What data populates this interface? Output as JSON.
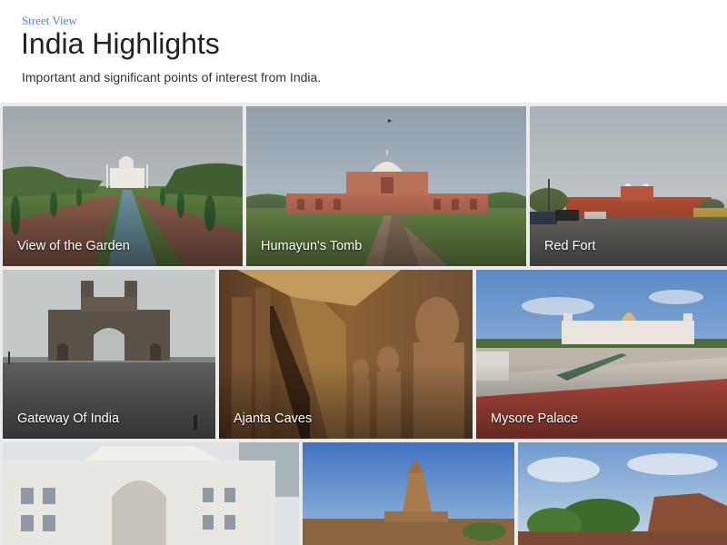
{
  "header": {
    "breadcrumb": "Street View",
    "title": "India Highlights",
    "subtitle": "Important and significant points of interest from India."
  },
  "tiles": [
    {
      "label": "View of the Garden",
      "selected": true
    },
    {
      "label": "Humayun's Tomb"
    },
    {
      "label": "Red Fort"
    },
    {
      "label": "Gateway Of India"
    },
    {
      "label": "Ajanta Caves"
    },
    {
      "label": "Mysore Palace"
    },
    {
      "label": ""
    },
    {
      "label": ""
    },
    {
      "label": ""
    }
  ],
  "colors": {
    "accent": "#5b8fe0",
    "breadcrumb": "#4a7fd3",
    "background": "#ebebeb"
  }
}
